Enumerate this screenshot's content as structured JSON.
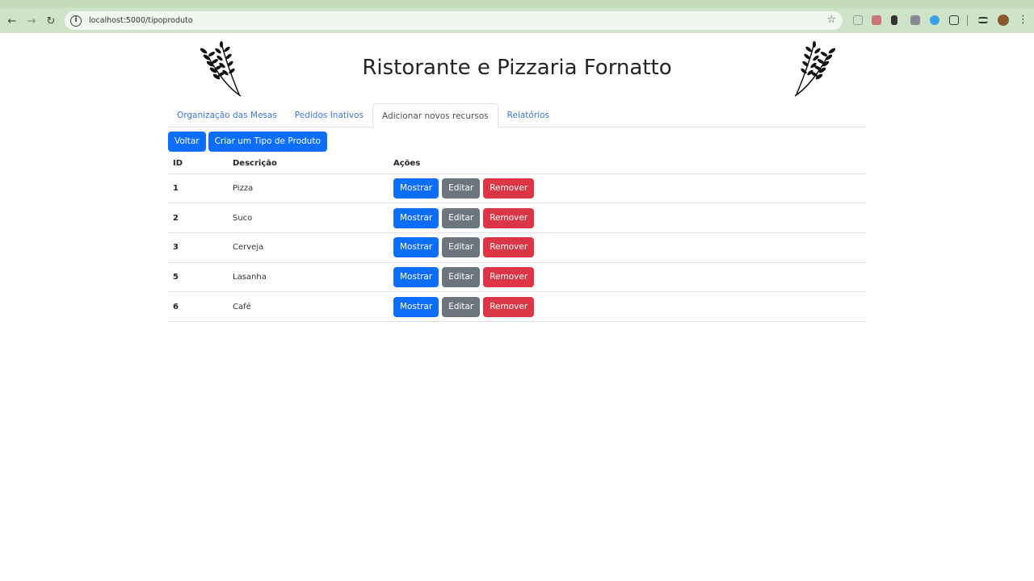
{
  "browser": {
    "url": "localhost:5000/tipoproduto"
  },
  "site": {
    "title": "Ristorante e Pizzaria Fornatto"
  },
  "tabs": [
    {
      "label": "Organização das Mesas",
      "active": false
    },
    {
      "label": "Pedidos Inativos",
      "active": false
    },
    {
      "label": "Adicionar novos recursos",
      "active": true
    },
    {
      "label": "Relatórios",
      "active": false
    }
  ],
  "toolbar": {
    "back_label": "Voltar",
    "create_label": "Criar um Tipo de Produto"
  },
  "table": {
    "headers": [
      "ID",
      "Descrição",
      "Ações"
    ],
    "rows": [
      {
        "id": "1",
        "descricao": "Pizza"
      },
      {
        "id": "2",
        "descricao": "Suco"
      },
      {
        "id": "3",
        "descricao": "Cerveja"
      },
      {
        "id": "5",
        "descricao": "Lasanha"
      },
      {
        "id": "6",
        "descricao": "Café"
      }
    ]
  },
  "row_actions": {
    "show_label": "Mostrar",
    "edit_label": "Editar",
    "remove_label": "Remover"
  },
  "colors": {
    "primary": "#0d6efd",
    "secondary": "#6c757d",
    "danger": "#dc3545",
    "browser_frame": "#cfe3c9"
  }
}
